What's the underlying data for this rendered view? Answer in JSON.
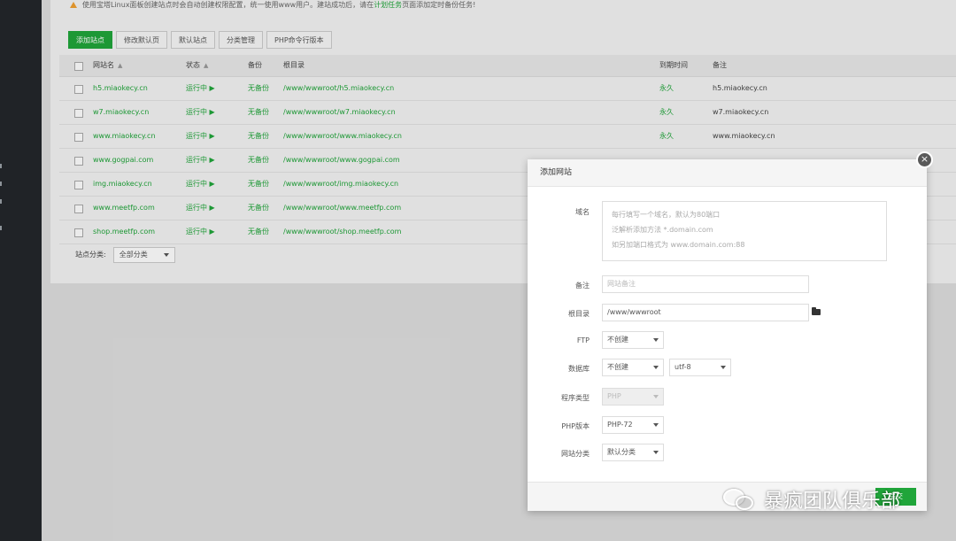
{
  "notice": {
    "text_before": "使用宝塔Linux面板创建站点时会自动创建权限配置，统一使用www用户。建站成功后，请在",
    "link": "计划任务",
    "text_after": "页面添加定时备份任务!"
  },
  "toolbar": {
    "add_site": "添加站点",
    "edit_default_page": "修改默认页",
    "default_site": "默认站点",
    "category_manage": "分类管理",
    "php_cli": "PHP命令行版本"
  },
  "table": {
    "headers": {
      "name": "网站名",
      "status": "状态",
      "backup": "备份",
      "root": "根目录",
      "expire": "到期时间",
      "note": "备注"
    },
    "rows": [
      {
        "name": "h5.miaokecy.cn",
        "status": "运行中",
        "backup": "无备份",
        "root": "/www/wwwroot/h5.miaokecy.cn",
        "expire": "永久",
        "note": "h5.miaokecy.cn"
      },
      {
        "name": "w7.miaokecy.cn",
        "status": "运行中",
        "backup": "无备份",
        "root": "/www/wwwroot/w7.miaokecy.cn",
        "expire": "永久",
        "note": "w7.miaokecy.cn"
      },
      {
        "name": "www.miaokecy.cn",
        "status": "运行中",
        "backup": "无备份",
        "root": "/www/wwwroot/www.miaokecy.cn",
        "expire": "永久",
        "note": "www.miaokecy.cn"
      },
      {
        "name": "www.gogpai.com",
        "status": "运行中",
        "backup": "无备份",
        "root": "/www/wwwroot/www.gogpai.com",
        "expire": "",
        "note": ""
      },
      {
        "name": "img.miaokecy.cn",
        "status": "运行中",
        "backup": "无备份",
        "root": "/www/wwwroot/img.miaokecy.cn",
        "expire": "",
        "note": ""
      },
      {
        "name": "www.meetfp.com",
        "status": "运行中",
        "backup": "无备份",
        "root": "/www/wwwroot/www.meetfp.com",
        "expire": "",
        "note": ""
      },
      {
        "name": "shop.meetfp.com",
        "status": "运行中",
        "backup": "无备份",
        "root": "/www/wwwroot/shop.meetfp.com",
        "expire": "",
        "note": ""
      }
    ]
  },
  "footer": {
    "category_label": "站点分类:",
    "category_value": "全部分类"
  },
  "modal": {
    "title": "添加网站",
    "domain_label": "域名",
    "domain_lines": [
      "每行填写一个域名，默认为80端口",
      "泛解析添加方法 *.domain.com",
      "如另加端口格式为 www.domain.com:88"
    ],
    "note_label": "备注",
    "note_placeholder": "网站备注",
    "root_label": "根目录",
    "root_value": "/www/wwwroot",
    "ftp_label": "FTP",
    "ftp_value": "不创建",
    "db_label": "数据库",
    "db_value": "不创建",
    "charset_value": "utf-8",
    "program_label": "程序类型",
    "program_value": "PHP",
    "php_label": "PHP版本",
    "php_value": "PHP-72",
    "category_label": "网站分类",
    "category_value": "默认分类",
    "close_glyph": "×",
    "submit_label": "提交"
  },
  "watermark": {
    "text": "暴疯团队俱乐部"
  }
}
